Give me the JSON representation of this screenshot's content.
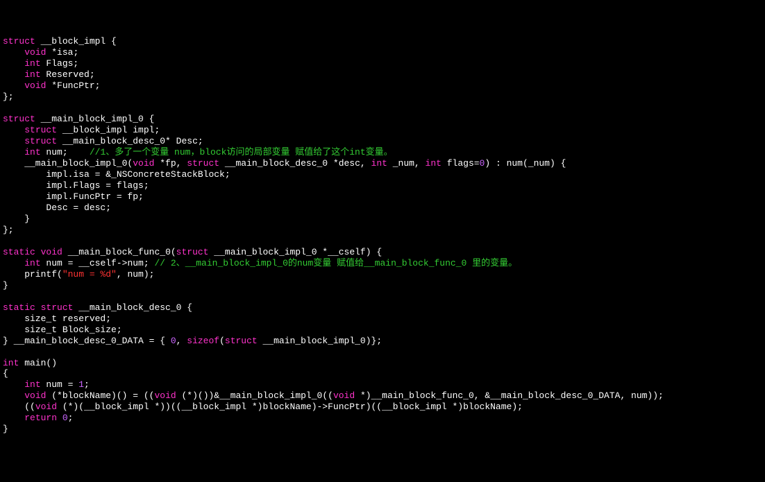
{
  "code": {
    "l1": {
      "k1": "struct",
      "t1": " __block_impl {"
    },
    "l2": {
      "k1": "void",
      "t1": " *isa;"
    },
    "l3": {
      "k1": "int",
      "t1": " Flags;"
    },
    "l4": {
      "k1": "int",
      "t1": " Reserved;"
    },
    "l5": {
      "k1": "void",
      "t1": " *FuncPtr;"
    },
    "l6": {
      "t1": "};"
    },
    "l7": {
      "t1": ""
    },
    "l8": {
      "k1": "struct",
      "t1": " __main_block_impl_0 {"
    },
    "l9": {
      "k1": "struct",
      "t1": " __block_impl impl;"
    },
    "l10": {
      "k1": "struct",
      "t1": " __main_block_desc_0* Desc;"
    },
    "l11": {
      "k1": "int",
      "t1": " num;    ",
      "c1": "//1、多了一个变量 num，block访问的局部变量 赋值给了这个int变量。"
    },
    "l12": {
      "t1": "    __main_block_impl_0(",
      "k1": "void",
      "t2": " *fp, ",
      "k2": "struct",
      "t3": " __main_block_desc_0 *desc, ",
      "k3": "int",
      "t4": " _num, ",
      "k4": "int",
      "t5": " flags=",
      "n1": "0",
      "t6": ") : num(_num) {"
    },
    "l13": {
      "t1": "        impl.isa = &_NSConcreteStackBlock;"
    },
    "l14": {
      "t1": "        impl.Flags = flags;"
    },
    "l15": {
      "t1": "        impl.FuncPtr = fp;"
    },
    "l16": {
      "t1": "        Desc = desc;"
    },
    "l17": {
      "t1": "    }"
    },
    "l18": {
      "t1": "};"
    },
    "l19": {
      "t1": ""
    },
    "l20": {
      "k1": "static",
      "t1": " ",
      "k2": "void",
      "t2": " __main_block_func_0(",
      "k3": "struct",
      "t3": " __main_block_impl_0 *__cself) {"
    },
    "l21": {
      "k1": "int",
      "t1": " num = __cself->num; ",
      "c1": "// 2、__main_block_impl_0的num变量 赋值给__main_block_func_0 里的变量。"
    },
    "l22": {
      "t1": "    printf(",
      "s1": "\"num = %d\"",
      "t2": ", num);"
    },
    "l23": {
      "t1": "}"
    },
    "l24": {
      "t1": ""
    },
    "l25": {
      "k1": "static",
      "t1": " ",
      "k2": "struct",
      "t2": " __main_block_desc_0 {"
    },
    "l26": {
      "t1": "    size_t reserved;"
    },
    "l27": {
      "t1": "    size_t Block_size;"
    },
    "l28": {
      "t1": "} __main_block_desc_0_DATA = { ",
      "n1": "0",
      "t2": ", ",
      "k1": "sizeof",
      "t3": "(",
      "k2": "struct",
      "t4": " __main_block_impl_0)};"
    },
    "l29": {
      "t1": ""
    },
    "l30": {
      "k1": "int",
      "t1": " main()"
    },
    "l31": {
      "t1": "{"
    },
    "l32": {
      "k1": "int",
      "t1": " num = ",
      "n1": "1",
      "t2": ";"
    },
    "l33": {
      "k1": "void",
      "t1": " (*blockName)() = ((",
      "k2": "void",
      "t2": " (*)())&__main_block_impl_0((",
      "k3": "void",
      "t3": " *)__main_block_func_0, &__main_block_desc_0_DATA, num));"
    },
    "l34": {
      "t1": "    ((",
      "k1": "void",
      "t2": " (*)(__block_impl *))((__block_impl *)blockName)->FuncPtr)((__block_impl *)blockName);"
    },
    "l35": {
      "k1": "return",
      "t1": " ",
      "n1": "0",
      "t2": ";"
    },
    "l36": {
      "t1": "}"
    }
  }
}
